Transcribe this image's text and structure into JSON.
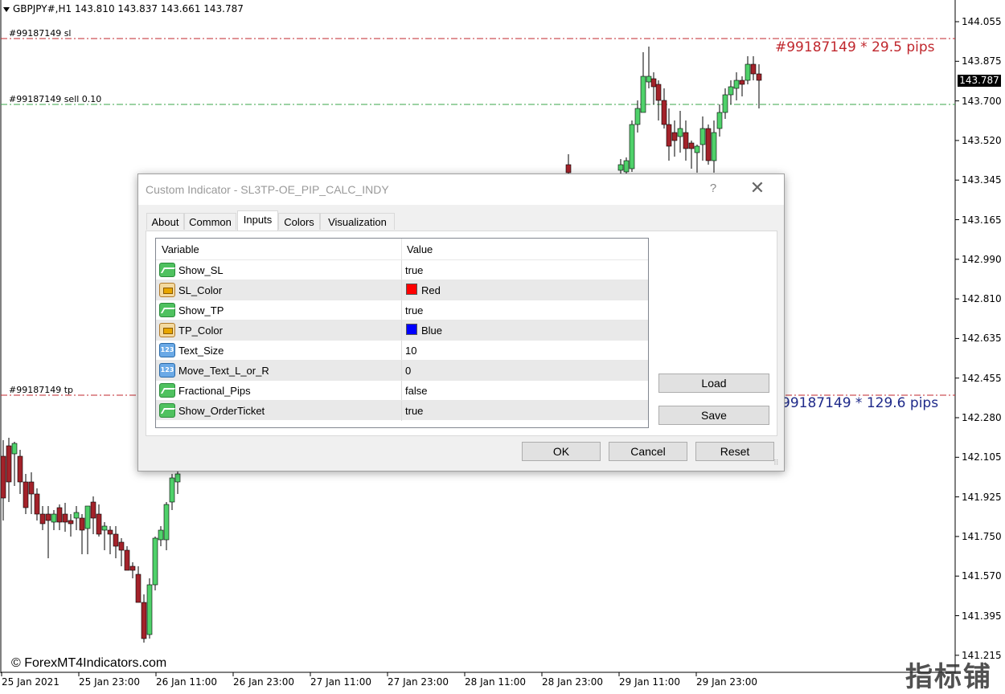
{
  "chart": {
    "header": "GBPJPY#,H1  143.810 143.837 143.661 143.787",
    "lines": {
      "sl_label": "#99187149 sl",
      "entry_label": "#99187149 sell 0.10",
      "tp_label": "#99187149 tp"
    },
    "sl_pips_text": "#99187149 * 29.5 pips",
    "tp_pips_text": "99187149 * 129.6 pips",
    "current_price": "143.787",
    "price_ticks": [
      "144.055",
      "143.875",
      "143.700",
      "143.520",
      "143.345",
      "143.165",
      "142.990",
      "142.810",
      "142.635",
      "142.455",
      "142.280",
      "142.105",
      "141.925",
      "141.750",
      "141.570",
      "141.395",
      "141.215"
    ],
    "time_ticks": [
      "25 Jan 2021",
      "25 Jan 23:00",
      "26 Jan 11:00",
      "26 Jan 23:00",
      "27 Jan 11:00",
      "27 Jan 23:00",
      "28 Jan 11:00",
      "28 Jan 23:00",
      "29 Jan 11:00",
      "29 Jan 23:00"
    ],
    "copyright": "© ForexMT4Indicators.com",
    "watermark": "指标铺",
    "colors": {
      "sl": "#c0272d",
      "tp": "#1f2a8a",
      "entry": "#3aa64a",
      "bull": "#4fd16a",
      "bear": "#a3222a"
    }
  },
  "dialog": {
    "title": "Custom Indicator - SL3TP-OE_PIP_CALC_INDY",
    "help": "?",
    "close": "✕",
    "tabs": [
      "About",
      "Common",
      "Inputs",
      "Colors",
      "Visualization"
    ],
    "active_tab": "Inputs",
    "columns": {
      "variable": "Variable",
      "value": "Value"
    },
    "rows": [
      {
        "icon": "bool-icon",
        "variable": "Show_SL",
        "value": "true"
      },
      {
        "icon": "color-icon",
        "variable": "SL_Color",
        "value": "Red",
        "swatch": "#ff0000"
      },
      {
        "icon": "bool-icon",
        "variable": "Show_TP",
        "value": "true"
      },
      {
        "icon": "color-icon",
        "variable": "TP_Color",
        "value": "Blue",
        "swatch": "#0000ff"
      },
      {
        "icon": "number-icon",
        "variable": "Text_Size",
        "value": "10"
      },
      {
        "icon": "number-icon",
        "variable": "Move_Text_L_or_R",
        "value": "0"
      },
      {
        "icon": "bool-icon",
        "variable": "Fractional_Pips",
        "value": "false"
      },
      {
        "icon": "bool-icon",
        "variable": "Show_OrderTicket",
        "value": "true"
      }
    ],
    "number_icon_text": "123",
    "buttons": {
      "load": "Load",
      "save": "Save",
      "ok": "OK",
      "cancel": "Cancel",
      "reset": "Reset"
    }
  }
}
